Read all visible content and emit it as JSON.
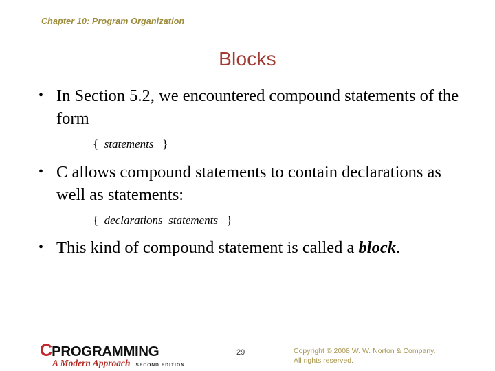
{
  "slide": {
    "chapter_header": "Chapter 10: Program Organization",
    "title": "Blocks"
  },
  "body": {
    "bullets": [
      {
        "marker": "•",
        "text": "In Section 5.2, we encountered compound statements of the form"
      },
      {
        "marker": "•",
        "text": "C allows compound statements to contain declarations as well as statements:"
      },
      {
        "marker": "•",
        "text_before": "This kind of compound statement is called a ",
        "emphasis": "block",
        "text_after": "."
      }
    ],
    "code_lines": [
      {
        "open_brace": "{",
        "items": [
          "statements"
        ],
        "close_brace": "}"
      },
      {
        "open_brace": "{",
        "items": [
          "declarations",
          "statements"
        ],
        "close_brace": "}"
      }
    ]
  },
  "footer": {
    "logo": {
      "initial": "C",
      "word": "PROGRAMMING",
      "subtitle": "A Modern Approach",
      "edition": "SECOND EDITION"
    },
    "page_number": "29",
    "copyright_line1": "Copyright © 2008 W. W. Norton & Company.",
    "copyright_line2": "All rights reserved."
  },
  "colors": {
    "header_olive": "#9c8c3c",
    "title_red": "#a23b33",
    "logo_red": "#c1272d",
    "copyright_olive": "#a8964f",
    "body_text": "#000000",
    "background": "#ffffff"
  }
}
